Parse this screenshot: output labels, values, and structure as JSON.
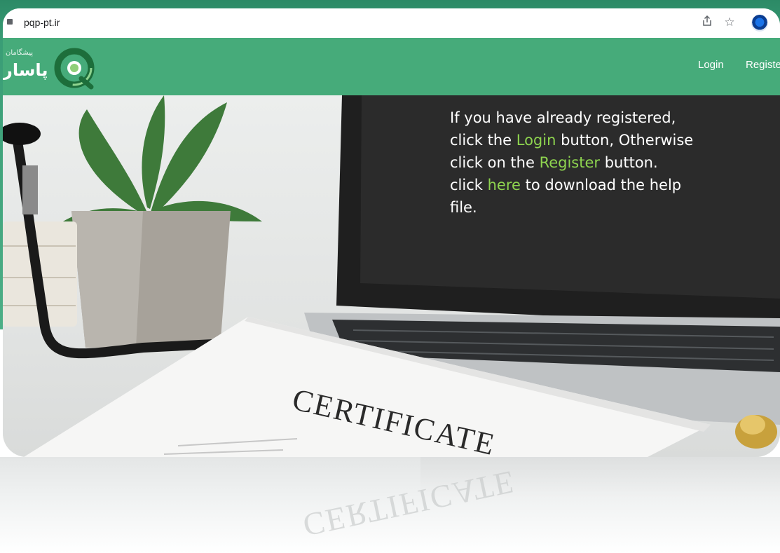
{
  "browser": {
    "url": "pqp-pt.ir",
    "icons": [
      "share-icon",
      "bookmark-star-icon",
      "profile-avatar"
    ]
  },
  "site": {
    "logo_small": "پیشگامان",
    "logo_big": "پاسار",
    "nav": {
      "login": "Login",
      "register": "Registe"
    },
    "colors": {
      "header": "#46ab7a",
      "link_highlight": "#8ed44f"
    }
  },
  "hero": {
    "line1": "If you have already registered,",
    "line2_pre": "click the ",
    "line2_link": "Login",
    "line2_post": " button, Otherwise",
    "line3_pre": "click on the ",
    "line3_link": "Register",
    "line3_post": " button.",
    "line4_pre": "click ",
    "line4_link": "here",
    "line4_post": " to download the help",
    "line5": "file.",
    "certificate_word": "CERTIFICATE"
  }
}
